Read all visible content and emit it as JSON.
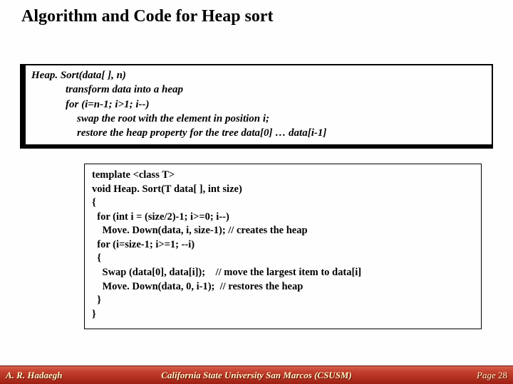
{
  "title": "Algorithm and Code for Heap sort",
  "algo": {
    "l0": "Heap. Sort(data[ ], n)",
    "l1": "transform data into a heap",
    "l2": "for (i=n-1; i>1; i--)",
    "l3": "swap the root with the element in position i;",
    "l4": "restore the heap property for the tree data[0] … data[i-1]"
  },
  "code": {
    "l0": "template <class T>",
    "l1": "void Heap. Sort(T data[ ], int size)",
    "l2": "{",
    "l3": "  for (int i = (size/2)-1; i>=0; i--)",
    "l4": "    Move. Down(data, i, size-1); // creates the heap",
    "l5": "  for (i=size-1; i>=1; --i)",
    "l6": "  {",
    "l7": "    Swap (data[0], data[i]);    // move the largest item to data[i]",
    "l8": "    Move. Down(data, 0, i-1);  // restores the heap",
    "l9": "  }",
    "l10": "}"
  },
  "footer": {
    "author": "A. R. Hadaegh",
    "institution": "California State University San Marcos (CSUSM)",
    "page_label": "Page ",
    "page_number": "28"
  }
}
